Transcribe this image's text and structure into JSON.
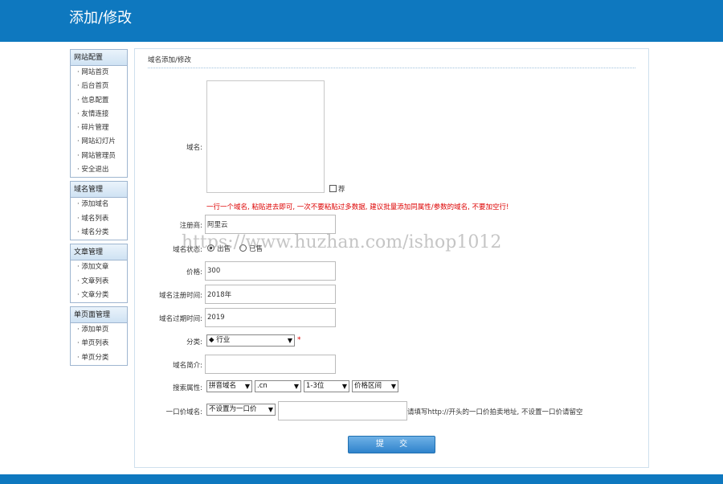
{
  "header": {
    "title": "添加/修改"
  },
  "sidebar": {
    "groups": [
      {
        "title": "网站配置",
        "items": [
          "· 网站首页",
          "· 后台首页",
          "· 信息配置",
          "· 友情连接",
          "· 碎片管理",
          "· 网站幻灯片",
          "· 网站管理员",
          "· 安全退出"
        ]
      },
      {
        "title": "域名管理",
        "items": [
          "· 添加域名",
          "· 域名列表",
          "· 域名分类"
        ]
      },
      {
        "title": "文章管理",
        "items": [
          "· 添加文章",
          "· 文章列表",
          "· 文章分类"
        ]
      },
      {
        "title": "单页面管理",
        "items": [
          "· 添加单页",
          "· 单页列表",
          "· 单页分类"
        ]
      }
    ]
  },
  "form": {
    "section_title": "域名添加/修改",
    "domain": {
      "label": "域名:",
      "value": "",
      "check_label": "荐",
      "note": "一行一个域名, 粘贴进去即可, 一次不要粘贴过多数据, 建议批量添加同属性/参数的域名, 不要加空行!"
    },
    "registrar": {
      "label": "注册商:",
      "value": "阿里云"
    },
    "status": {
      "label": "域名状态:",
      "option_on": "出售",
      "option_off": "已售"
    },
    "price": {
      "label": "价格:",
      "value": "300"
    },
    "reg_time": {
      "label": "域名注册时间:",
      "value": "2018年"
    },
    "exp_time": {
      "label": "域名过期时间:",
      "value": "2019"
    },
    "category": {
      "label": "分类:",
      "value": "◆ 行业",
      "required": "*"
    },
    "intro": {
      "label": "域名简介:",
      "value": ""
    },
    "search_attr": {
      "label": "搜索属性:",
      "select1": "拼音域名",
      "select2": ".cn",
      "select3": "1-3位",
      "select4": "价格区间"
    },
    "fixed_price": {
      "label": "一口价域名:",
      "select": "不设置为一口价",
      "url_value": "",
      "hint": "请填写http://开头的一口价拍卖地址, 不设置一口价请留空"
    },
    "submit_label": "提 交"
  },
  "watermark": "https://www.huzhan.com/ishop1012"
}
